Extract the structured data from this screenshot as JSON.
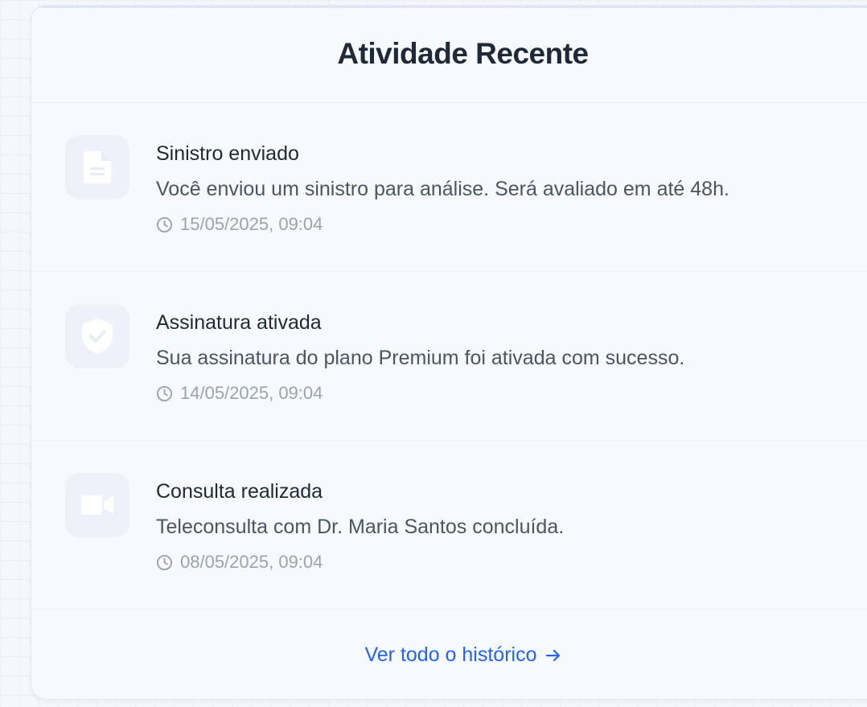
{
  "card": {
    "title": "Atividade Recente"
  },
  "activities": [
    {
      "icon": "document-icon",
      "title": "Sinistro enviado",
      "description": "Você enviou um sinistro para análise. Será avaliado em até 48h.",
      "timestamp": "15/05/2025, 09:04"
    },
    {
      "icon": "shield-check-icon",
      "title": "Assinatura ativada",
      "description": "Sua assinatura do plano Premium foi ativada com sucesso.",
      "timestamp": "14/05/2025, 09:04"
    },
    {
      "icon": "video-camera-icon",
      "title": "Consulta realizada",
      "description": "Teleconsulta com Dr. Maria Santos concluída.",
      "timestamp": "08/05/2025, 09:04"
    }
  ],
  "footer": {
    "link_label": "Ver todo o histórico",
    "link_icon": "arrow-right-icon"
  },
  "colors": {
    "accent": "#2563eb",
    "title_text": "#1f2937",
    "body_text": "#4b5563",
    "muted_text": "#9aa3af",
    "icon_tile": "#eef2f8",
    "icon_glyph": "#ffffff"
  }
}
